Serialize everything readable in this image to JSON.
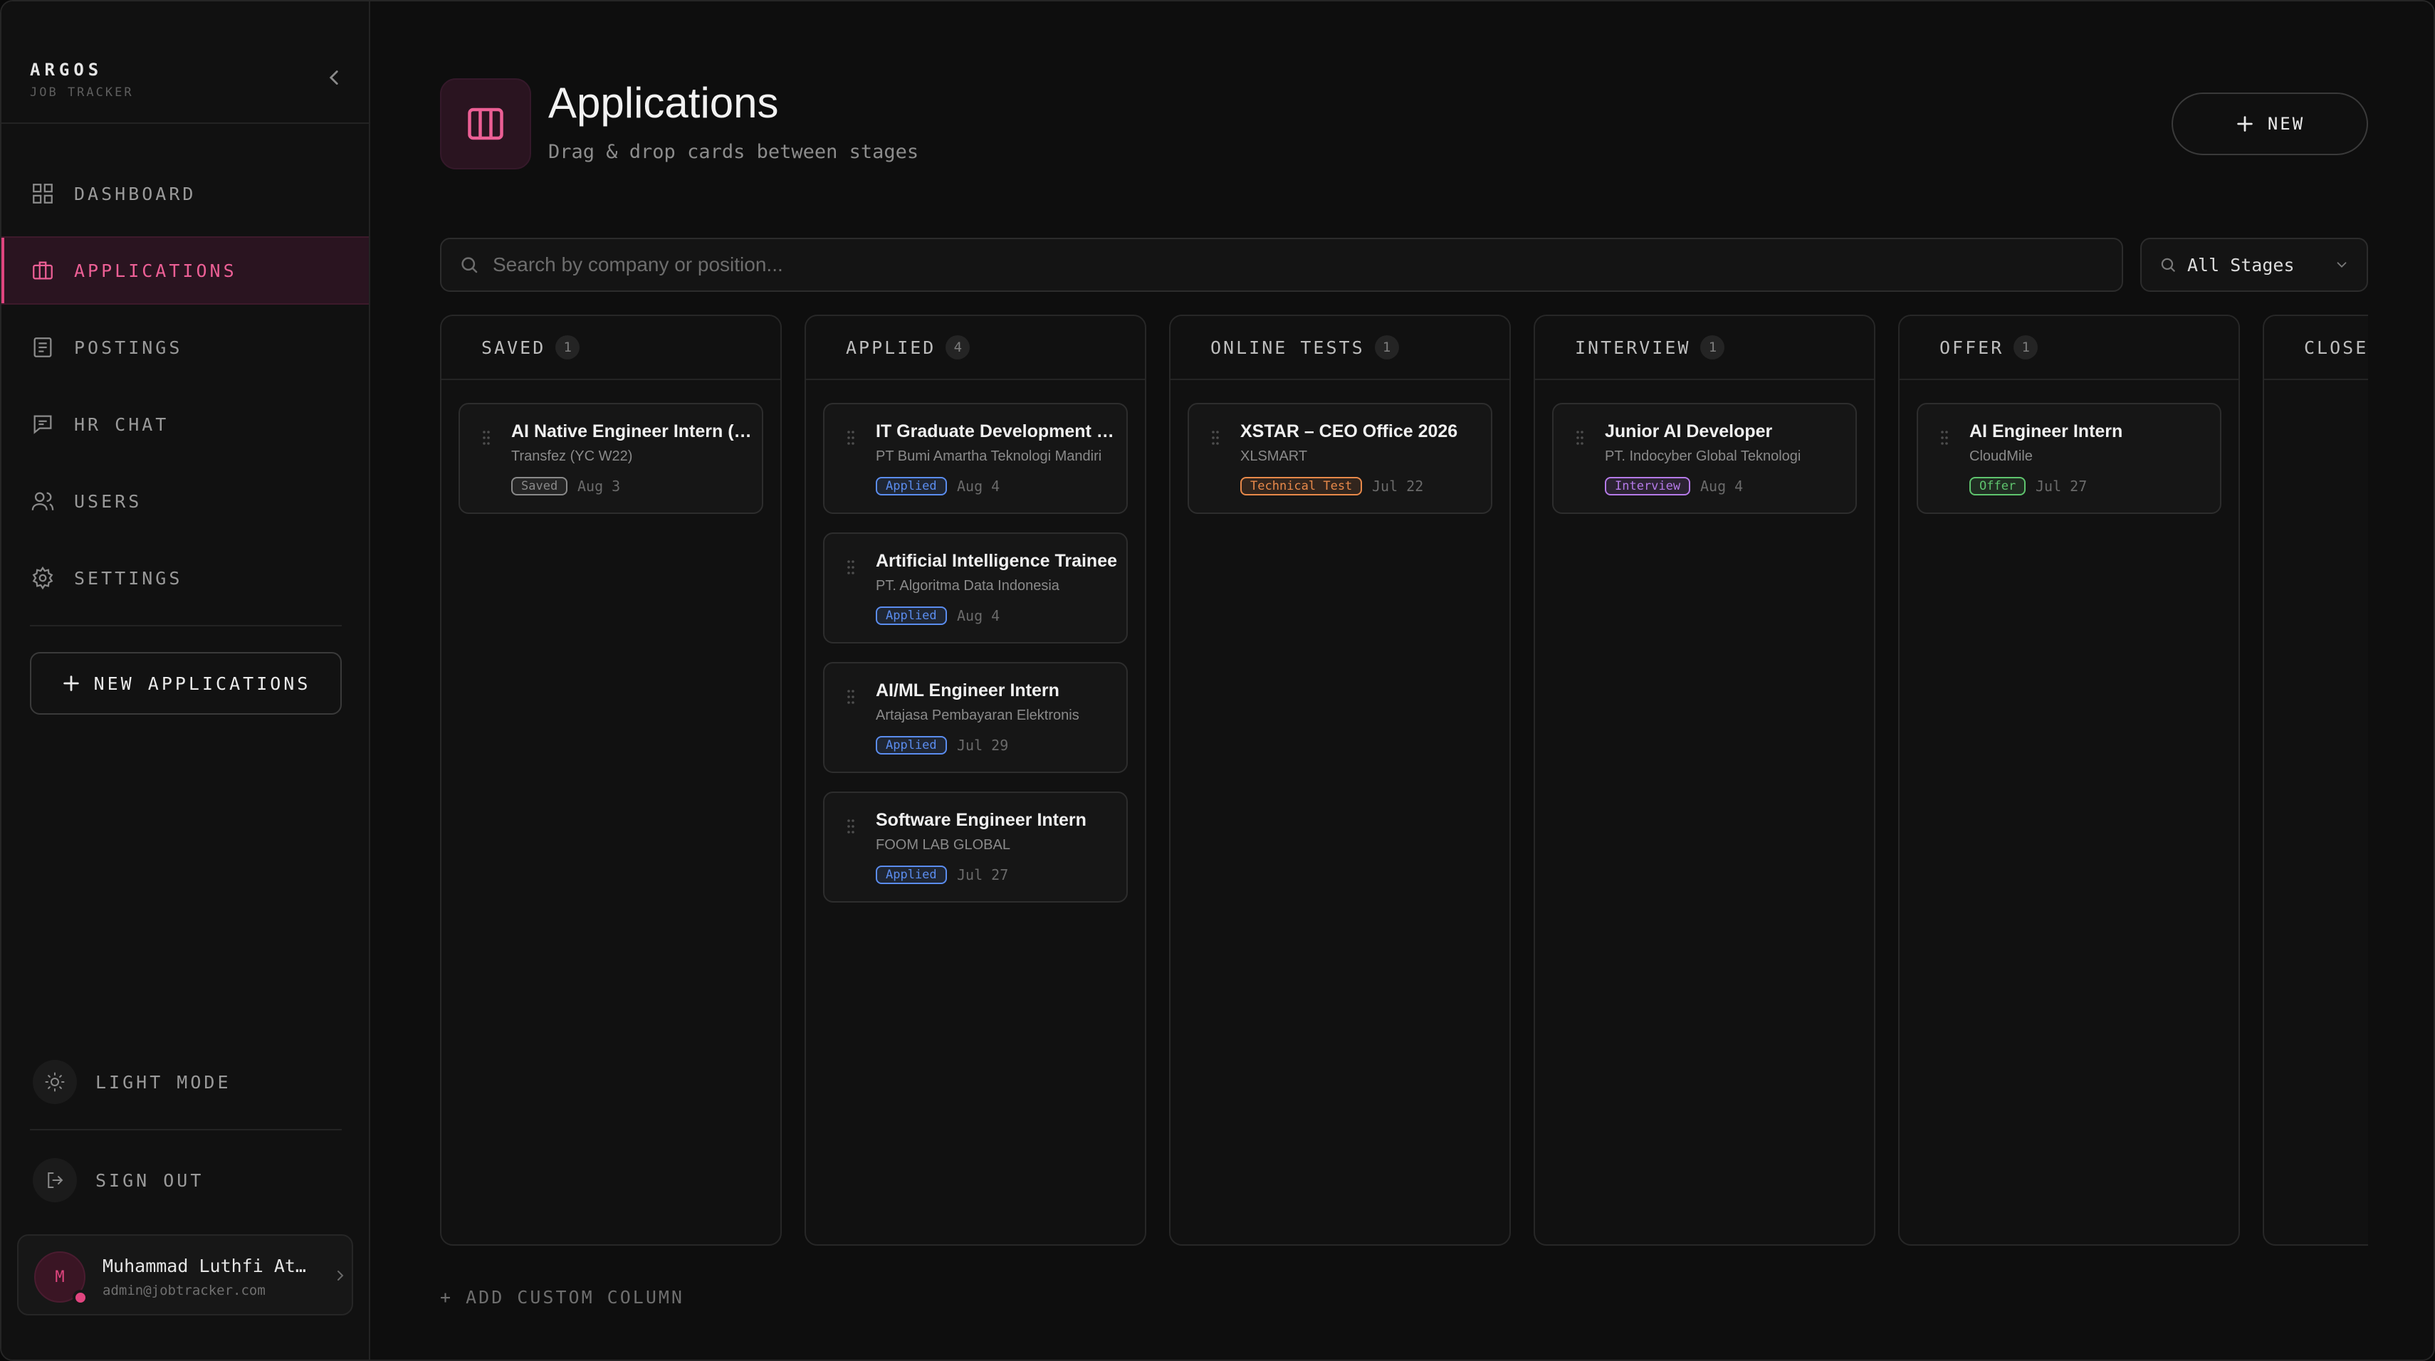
{
  "brand": {
    "name": "ARGOS",
    "subtitle": "JOB TRACKER"
  },
  "sidebar": {
    "items": [
      {
        "label": "DASHBOARD",
        "icon": "grid-icon"
      },
      {
        "label": "APPLICATIONS",
        "icon": "briefcase-icon",
        "active": true
      },
      {
        "label": "POSTINGS",
        "icon": "document-icon"
      },
      {
        "label": "HR CHAT",
        "icon": "chat-icon"
      },
      {
        "label": "USERS",
        "icon": "users-icon"
      },
      {
        "label": "SETTINGS",
        "icon": "gear-icon"
      }
    ],
    "new_button": "NEW APPLICATIONS",
    "theme_toggle": "LIGHT MODE",
    "sign_out": "SIGN OUT",
    "user": {
      "initial": "M",
      "name": "Muhammad Luthfi At…",
      "email": "admin@jobtracker.com"
    }
  },
  "header": {
    "title": "Applications",
    "subtitle": "Drag & drop cards between stages",
    "new_button": "NEW"
  },
  "filters": {
    "search_placeholder": "Search by company or position...",
    "stage_select": "All Stages"
  },
  "columns": [
    {
      "title": "SAVED",
      "count": "1",
      "cards": [
        {
          "title": "AI Native Engineer Intern (Fr...",
          "company": "Transfez (YC W22)",
          "badge": "Saved",
          "badge_color": "#8a8a8a",
          "date": "Aug 3"
        }
      ]
    },
    {
      "title": "APPLIED",
      "count": "4",
      "cards": [
        {
          "title": "IT Graduate Development Pr...",
          "company": "PT Bumi Amartha Teknologi Mandiri",
          "badge": "Applied",
          "badge_color": "#5b8def",
          "date": "Aug 4"
        },
        {
          "title": "Artificial Intelligence Trainee",
          "company": "PT. Algoritma Data Indonesia",
          "badge": "Applied",
          "badge_color": "#5b8def",
          "date": "Aug 4"
        },
        {
          "title": "AI/ML Engineer Intern",
          "company": "Artajasa Pembayaran Elektronis",
          "badge": "Applied",
          "badge_color": "#5b8def",
          "date": "Jul 29"
        },
        {
          "title": "Software Engineer Intern",
          "company": "FOOM LAB GLOBAL",
          "badge": "Applied",
          "badge_color": "#5b8def",
          "date": "Jul 27"
        }
      ]
    },
    {
      "title": "ONLINE TESTS",
      "count": "1",
      "cards": [
        {
          "title": "XSTAR – CEO Office 2026",
          "company": "XLSMART",
          "badge": "Technical Test",
          "badge_color": "#e8894a",
          "date": "Jul 22"
        }
      ]
    },
    {
      "title": "INTERVIEW",
      "count": "1",
      "cards": [
        {
          "title": "Junior AI Developer",
          "company": "PT. Indocyber Global Teknologi",
          "badge": "Interview",
          "badge_color": "#b57ae8",
          "date": "Aug 4"
        }
      ]
    },
    {
      "title": "OFFER",
      "count": "1",
      "cards": [
        {
          "title": "AI Engineer Intern",
          "company": "CloudMile",
          "badge": "Offer",
          "badge_color": "#5fc46e",
          "date": "Jul 27"
        }
      ]
    },
    {
      "title": "CLOSED",
      "count": "",
      "cards": []
    }
  ],
  "add_column": "+ ADD CUSTOM COLUMN",
  "colors": {
    "accent": "#e0457f",
    "background": "#0e0e0e",
    "surface": "#111111"
  }
}
